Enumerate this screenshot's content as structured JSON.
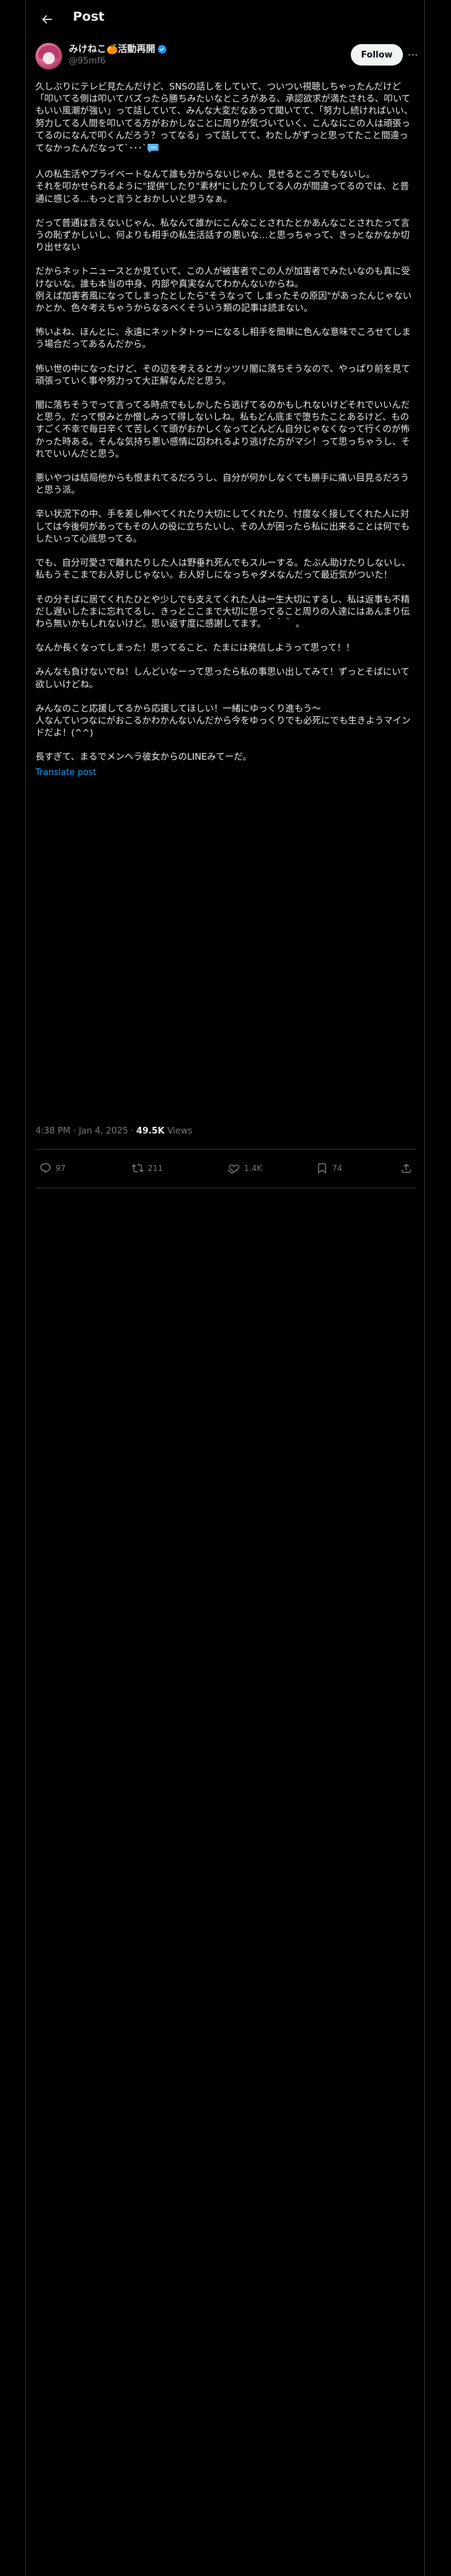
{
  "header": {
    "title": "Post"
  },
  "author": {
    "display_name": "みけねこ🍊活動再開",
    "handle": "@95mf6",
    "follow_label": "Follow"
  },
  "post": {
    "paragraphs": [
      "久しぶりにテレビ見たんだけど、SNSの話しをしていて、ついつい視聴しちゃったんだけど「叩いてる側は叩いてバズったら勝ちみたいなところがある、承認欲求が満たされる、叩いてもいい風潮が強い」って話していて、みんな大変だなあって聞いてて、「努力し続ければいい、努力してる人間を叩いてる方がおかしなことに周りが気づいていく、こんなにこの人は頑張ってるのになんで叩くんだろう？ってなる」って話してて、わたしがずっと思ってたこと間違ってなかったんだなって`･･･`",
      "人の私生活やプライベートなんて誰も分からないじゃん、見せるところでもないし。\nそれを叩かせられるように\"提供\"したり\"素材\"にしたりしてる人のが間違ってるのでは、と普通に感じる…もっと言うとおかしいと思うなぁ。",
      "だって普通は言えないじゃん、私なんて誰かにこんなことされたとかあんなことされたって言うの恥ずかしいし、何よりも相手の私生活話すの悪いな…と思っちゃって、きっとなかなか切り出せない",
      "だからネットニュースとか見ていて、この人が被害者でこの人が加害者でみたいなのも真に受けないな。誰も本当の中身、内部や真実なんてわかんないからね。\n例えば加害者風になってしまったとしたら\"そうなって しまったその原因\"があったんじゃないかとか、色々考えちゃうからなるべくそういう類の記事は読まない。",
      "怖いよね、ほんとに、永遠にネットタトゥーになるし相手を簡単に色んな意味でころせてしまう場合だってあるんだから。",
      "怖い世の中になったけど、その辺を考えるとガッツリ闇に落ちそうなので、やっぱり前を見て頑張っていく事や努力って大正解なんだと思う。",
      "闇に落ちそうでって言ってる時点でもしかしたら逃げてるのかもしれないけどそれでいいんだと思う。だって恨みとか憎しみって得しないしね。私もどん底まで堕ちたことあるけど、ものすごく不幸で毎日辛くて苦しくて頭がおかしくなってどんどん自分じゃなくなって行くのが怖かった時ある。そんな気持ち悪い感情に囚われるより逃げた方がマシ！って思っちゃうし、それでいいんだと思う。",
      "悪いやつは結局他からも恨まれてるだろうし、自分が何かしなくても勝手に痛い目見るだろうと思う派。",
      "辛い状況下の中、手を差し伸べてくれたり大切にしてくれたり、忖度なく接してくれた人に対しては今後何があってもその人の役に立ちたいし、その人が困ったら私に出来ることは何でもしたいって心底思ってる。",
      "でも、自分可愛さで離れたりした人は野垂れ死んでもスルーする。たぶん助けたりしないし、私もうそこまでお人好しじゃない。お人好しになっちゃダメなんだって最近気がついた！",
      "その分そばに居てくれたひとや少しでも支えてくれた人は一生大切にするし、私は返事も不精だし遅いしたまに忘れてるし、きっとここまで大切に思ってること周りの人達にはあんまり伝わら無いかもしれないけど。思い返す度に感謝してます。｀｀｀ 。",
      "なんか長くなってしまった！思ってること、たまには発信しようって思って！！",
      "みんなも負けないでね！しんどいなーって思ったら私の事思い出してみて！ずっとそばにいて欲しいけどね。",
      "みんなのこと応援してるから応援してほしい！一緒にゆっくり進もう〜\n人なんていつなにがおこるかわかんないんだから今をゆっくりでも必死にでも生きようマインドだよ！(^^)",
      "長すぎて、まるでメンヘラ彼女からのLINEみてーだ。"
    ],
    "translate_label": "Translate post"
  },
  "meta": {
    "time": "4:38 PM",
    "separator": "·",
    "date": "Jan 4, 2025",
    "views_count": "49.5K",
    "views_label": "Views"
  },
  "actions": {
    "replies": "97",
    "reposts": "211",
    "likes": "1.4K",
    "bookmarks": "74"
  },
  "colors": {
    "background": "#000000",
    "text": "#e7e9ea",
    "muted": "#71767b",
    "link": "#1d9bf0",
    "border": "#2f3336",
    "follow_bg": "#eff3f4"
  },
  "icons": {
    "back": "arrow-left-icon",
    "verified": "verified-badge-icon",
    "more": "more-horizontal-icon",
    "reply": "reply-icon",
    "repost": "repost-icon",
    "like": "heart-icon",
    "bookmark": "bookmark-icon",
    "share": "share-icon"
  }
}
